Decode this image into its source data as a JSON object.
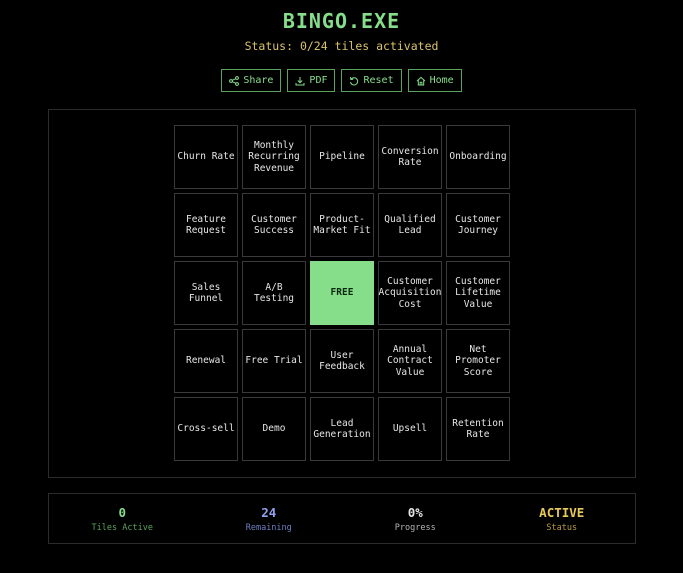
{
  "app": {
    "title": "BINGO.EXE",
    "status": "Status: 0/24 tiles activated"
  },
  "toolbar": {
    "share_label": "Share",
    "pdf_label": "PDF",
    "reset_label": "Reset",
    "home_label": "Home"
  },
  "board": {
    "tiles": [
      "Churn Rate",
      "Monthly\nRecurring\nRevenue",
      "Pipeline",
      "Conversion\nRate",
      "Onboarding",
      "Feature\nRequest",
      "Customer\nSuccess",
      "Product-\nMarket Fit",
      "Qualified\nLead",
      "Customer\nJourney",
      "Sales\nFunnel",
      "A/B\nTesting",
      "FREE",
      "Customer\nAcquisition\nCost",
      "Customer\nLifetime\nValue",
      "Renewal",
      "Free Trial",
      "User\nFeedback",
      "Annual\nContract\nValue",
      "Net\nPromoter\nScore",
      "Cross-sell",
      "Demo",
      "Lead\nGeneration",
      "Upsell",
      "Retention\nRate"
    ],
    "free_index": 12
  },
  "stats": [
    {
      "value": "0",
      "label": "Tiles Active",
      "color": "#86de8b",
      "label_color": "#5aa35e"
    },
    {
      "value": "24",
      "label": "Remaining",
      "color": "#8fa3f0",
      "label_color": "#6f7fc2"
    },
    {
      "value": "0%",
      "label": "Progress",
      "color": "#e6e6e6",
      "label_color": "#b5b5b5"
    },
    {
      "value": "ACTIVE",
      "label": "Status",
      "color": "#e8c95a",
      "label_color": "#b99b3c"
    }
  ],
  "colors": {
    "accent": "#86de8b",
    "status_text": "#d9c36a",
    "free_tile_bg": "#86de8b"
  },
  "icons": {
    "share": "share-icon",
    "pdf": "download-icon",
    "reset": "reset-icon",
    "home": "home-icon"
  }
}
